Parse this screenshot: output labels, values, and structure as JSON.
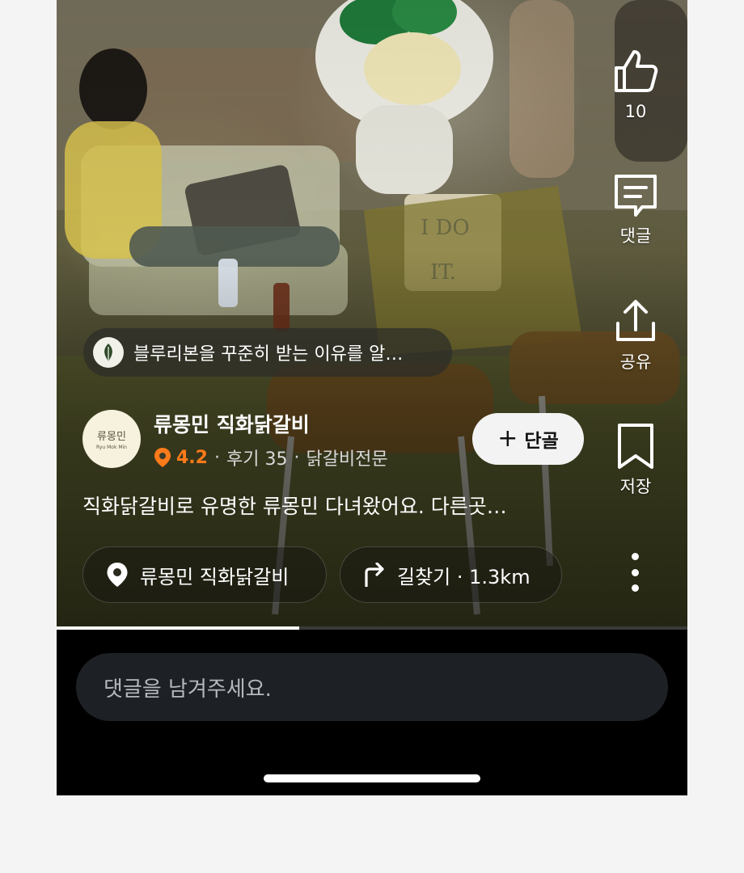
{
  "actions": {
    "like_count": "10",
    "comment_label": "댓글",
    "share_label": "공유",
    "save_label": "저장"
  },
  "notice_chip": {
    "text": "블루리본을 꾸준히 받는 이유를 알…"
  },
  "store": {
    "name": "류몽민 직화닭갈비",
    "logo_main": "류몽민",
    "logo_sub": "Ryu Mok Min",
    "rating": "4.2",
    "reviews": "후기 35",
    "category": "닭갈비전문",
    "follow_label": "단골"
  },
  "caption": "직화닭갈비로 유명한 류몽민 다녀왔어요. 다른곳…",
  "location_chip": {
    "label": "류몽민 직화닭갈비"
  },
  "directions_chip": {
    "label": "길찾기 · 1.3km"
  },
  "comment_input": {
    "placeholder": "댓글을 남겨주세요."
  },
  "video_progress": 0.385,
  "colors": {
    "accent_rating": "#ff7a1a",
    "comment_bg": "#1d2024",
    "follow_bg": "#f3f3f3"
  },
  "icons": {
    "like": "thumbs-up-icon",
    "comment": "comment-icon",
    "share": "share-icon",
    "save": "bookmark-icon",
    "more": "more-vertical-icon",
    "pin": "location-pin-icon",
    "directions": "turn-right-arrow-icon",
    "plus": "plus-icon"
  }
}
